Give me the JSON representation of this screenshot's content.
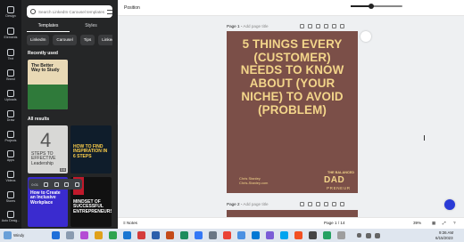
{
  "rail": {
    "items": [
      {
        "label": "Design",
        "icon": "layout-icon"
      },
      {
        "label": "Elements",
        "icon": "shapes-icon"
      },
      {
        "label": "Text",
        "icon": "text-icon"
      },
      {
        "label": "Brand",
        "icon": "crown-icon"
      },
      {
        "label": "Uploads",
        "icon": "upload-icon"
      },
      {
        "label": "Draw",
        "icon": "pen-icon"
      },
      {
        "label": "Projects",
        "icon": "folder-icon"
      },
      {
        "label": "Apps",
        "icon": "grid-icon"
      },
      {
        "label": "Videos",
        "icon": "video-icon"
      },
      {
        "label": "Stores",
        "icon": "store-icon"
      },
      {
        "label": "Auto Desig...",
        "icon": "magic-icon"
      }
    ]
  },
  "panel": {
    "search_value": "Search LinkedIn Carousel templates",
    "tabs": [
      "Templates",
      "Styles"
    ],
    "chips": [
      "LinkedIn",
      "Carousel",
      "Tips",
      "Linked"
    ],
    "recently_used": "Recently used",
    "all_results": "All results",
    "thumbs": {
      "recent1": "The Better Way to Study",
      "result1": "STEPS TO EFFECTIVE Leadership",
      "result1_num": "4",
      "result1_dur": "0:6",
      "result2": "HOW TO FIND INSPIRATION IN 6 STEPS",
      "result3": "How to Create an Inclusive Workplace",
      "result4": "MINDSET OF SUCCESSFUL ENTREPRENEURS",
      "result4_num": "5"
    },
    "player_time": "0:01"
  },
  "topbar": {
    "position_label": "Position"
  },
  "canvas": {
    "page1_label": "Page 1",
    "page1_title_placeholder": "Add page title",
    "page2_label": "Page 2",
    "page2_title_placeholder": "Add page title",
    "headline": "5 THINGS EVERY (CUSTOMER) NEEDS TO KNOW ABOUT (YOUR NICHE) TO AVOID (PROBLEM)",
    "author_name": "Chris Stanley",
    "author_site": "Chris-Stanley.com",
    "brand_top": "THE BALANCED",
    "brand_mid": "DAD",
    "brand_bot": "PRENEUR",
    "page_bg": "#7b4f48",
    "text_color": "#f3d58a"
  },
  "statusbar": {
    "notes": "Notes",
    "page_counter": "Page 1 / 14",
    "zoom": "39%",
    "zoom_fraction": 0.39
  },
  "taskbar": {
    "weather": "Windy",
    "time": "9:36 AM",
    "date": "6/15/2023"
  }
}
